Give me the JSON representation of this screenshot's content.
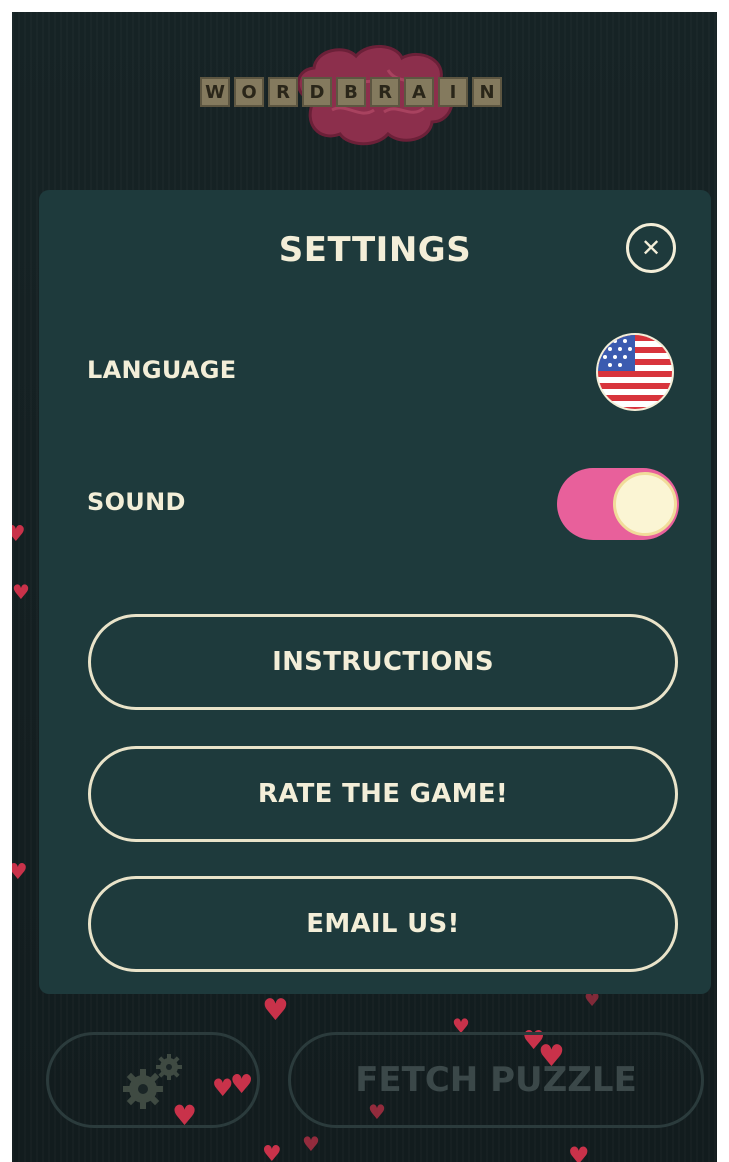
{
  "logo": {
    "letters": [
      "W",
      "O",
      "R",
      "D",
      "B",
      "R",
      "A",
      "I",
      "N"
    ]
  },
  "settings": {
    "title": "SETTINGS",
    "close_glyph": "✕",
    "language_label": "LANGUAGE",
    "language_flag": "us-flag-icon",
    "sound_label": "SOUND",
    "sound_on": true,
    "buttons": {
      "instructions": "INSTRUCTIONS",
      "rate": "RATE THE GAME!",
      "email": "EMAIL US!"
    }
  },
  "bottom_bar": {
    "settings_icon": "gears-icon",
    "fetch_label": "FETCH PUZZLE"
  },
  "colors": {
    "panel": "#1e3a3c",
    "text": "#f3eed8",
    "toggle_on": "#e8609b",
    "heart": "#c9324a"
  }
}
